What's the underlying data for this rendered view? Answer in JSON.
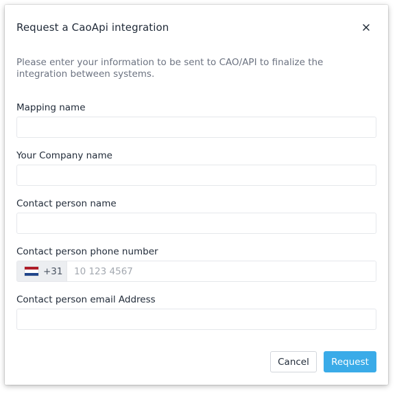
{
  "dialog": {
    "title": "Request a CaoApi integration",
    "description": "Please enter your information to be sent to CAO/API to finalize the integration between systems.",
    "close_icon": "close-icon"
  },
  "fields": {
    "mapping_name": {
      "label": "Mapping name",
      "value": ""
    },
    "company_name": {
      "label": "Your Company name",
      "value": ""
    },
    "contact_name": {
      "label": "Contact person name",
      "value": ""
    },
    "contact_phone": {
      "label": "Contact person phone number",
      "country_flag": "netherlands-flag-icon",
      "dial_code": "+31",
      "placeholder": "10 123 4567",
      "value": ""
    },
    "contact_email": {
      "label": "Contact person email Address",
      "value": ""
    }
  },
  "actions": {
    "cancel_label": "Cancel",
    "request_label": "Request"
  },
  "colors": {
    "primary": "#3aabe8",
    "flag_red": "#ae1c28",
    "flag_white": "#ffffff",
    "flag_blue": "#21468b"
  }
}
